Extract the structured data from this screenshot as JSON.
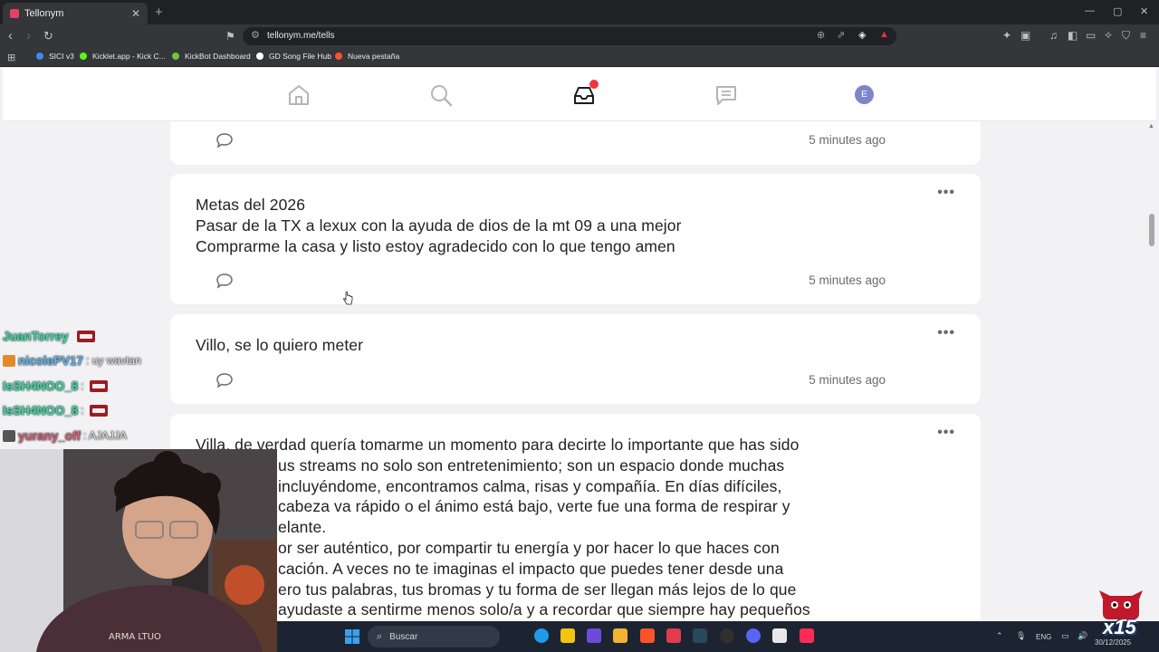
{
  "browser": {
    "tab_title": "Tellonym",
    "tab_close": "✕",
    "new_tab": "+",
    "url": "tellonym.me/tells",
    "window_controls": {
      "minimize": "—",
      "maximize": "▢",
      "close": "✕"
    }
  },
  "bookmarks": [
    {
      "label": "SICI v3",
      "color": "#3a8ee6"
    },
    {
      "label": "Kicklet.app - Kick C...",
      "color": "#53fc18"
    },
    {
      "label": "KickBot Dashboard",
      "color": "#6bc93a"
    },
    {
      "label": "GD Song File Hub",
      "color": "#ffffff"
    },
    {
      "label": "Nueva pestaña",
      "color": "#fb542b"
    }
  ],
  "site_nav": {
    "items": [
      {
        "name": "home-icon"
      },
      {
        "name": "search-icon"
      },
      {
        "name": "inbox-icon",
        "active": true,
        "has_notification": true
      },
      {
        "name": "chats-icon"
      },
      {
        "name": "profile-avatar"
      }
    ],
    "avatar_letter": "E"
  },
  "tells": [
    {
      "lines": [],
      "time": "5 minutes ago",
      "partial_top": true
    },
    {
      "lines": [
        "Metas del 2026",
        "Pasar de la TX a lexux con la ayuda de dios de la mt 09 a una mejor",
        "Comprarme la casa y listo estoy agradecido con lo que tengo amen"
      ],
      "time": "5 minutes ago"
    },
    {
      "lines": [
        "Villo, se lo quiero meter"
      ],
      "time": "5 minutes ago"
    },
    {
      "lines": [
        "Villa, de verdad quería tomarme un momento para decirte lo importante que has sido",
        "us streams no solo son entretenimiento; son un espacio donde muchas",
        "incluyéndome, encontramos calma, risas y compañía. En días difíciles,",
        "cabeza va rápido o el ánimo está bajo, verte fue una forma de respirar y",
        "elante.",
        "or ser auténtico, por compartir tu energía y por hacer lo que haces con",
        "cación. A veces no te imaginas el impacto que puedes tener desde una",
        "ero tus palabras, tus bromas y tu forma de ser llegan más lejos de lo que",
        "ayudaste a sentirme menos solo/a y a recordar que siempre hay pequeños"
      ],
      "time": ""
    }
  ],
  "chat": [
    {
      "user": "JuanTorrey",
      "message": "",
      "emote": true,
      "badge": "#9c1c26"
    },
    {
      "user": "nicolePV17",
      "message": ": uy wavtan",
      "emote": false,
      "badge": "#e08a2a"
    },
    {
      "user": "IsSH4NOO_8",
      "message": ":",
      "emote": true,
      "badge": ""
    },
    {
      "user": "IsSH4NOO_8",
      "message": ":",
      "emote": true,
      "badge": ""
    },
    {
      "user": "yurany_off",
      "message": ": AJAJJA",
      "emote": false,
      "badge": "#555555"
    }
  ],
  "taskbar": {
    "search_placeholder": "Buscar",
    "tray_lang": "ENG",
    "clock_date": "30/12/2025",
    "apps": [
      "#0f78d4",
      "#1e9de6",
      "#f1c40f",
      "#6c4bd8",
      "#f2b233",
      "#fb542b",
      "#e23b4e",
      "#2a475e",
      "#202020",
      "#5865f2",
      "#e8e8e8",
      "#fe2c55"
    ]
  },
  "overlay": {
    "multiplier": "x15"
  },
  "colors": {
    "accent_red": "#f23340",
    "avatar": "#7d86c9",
    "chat_name": "#46d29a"
  }
}
